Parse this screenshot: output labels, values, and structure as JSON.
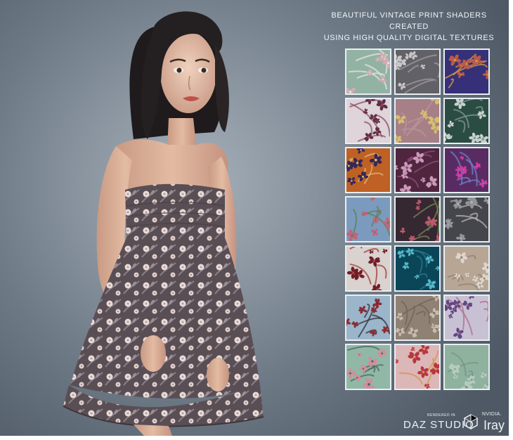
{
  "promo": {
    "headline_line1": "BEAUTIFUL VINTAGE PRINT SHADERS CREATED",
    "headline_line2": "USING HIGH QUALITY DIGITAL TEXTURES"
  },
  "branding": {
    "rendered_in": "RENDERED IN",
    "daz_studio": "DAZ STUDIO",
    "nvidia": "NVIDIA.",
    "iray": "Iray"
  },
  "swatches": [
    {
      "bg": "#9fc3b2",
      "fg": "#e8b9c2",
      "accent": "#f6f6f1"
    },
    {
      "bg": "#6b6a70",
      "fg": "#d9d7d8",
      "accent": "#a9a6aa"
    },
    {
      "bg": "#3a3583",
      "fg": "#c9634f",
      "accent": "#e7a14b"
    },
    {
      "bg": "#f1e7ec",
      "fg": "#6c3147",
      "accent": "#9d5b74"
    },
    {
      "bg": "#b58a93",
      "fg": "#e6d176",
      "accent": "#caa1a9"
    },
    {
      "bg": "#2f5348",
      "fg": "#d8e3df",
      "accent": "#8aa39a"
    },
    {
      "bg": "#d06a28",
      "fg": "#3a2c5e",
      "accent": "#f1c37b"
    },
    {
      "bg": "#572944",
      "fg": "#d9a6c8",
      "accent": "#9b5387"
    },
    {
      "bg": "#60306b",
      "fg": "#e53fb0",
      "accent": "#7a8bd8"
    },
    {
      "bg": "#86a9cf",
      "fg": "#d96a86",
      "accent": "#6c8a5a"
    },
    {
      "bg": "#3a2c36",
      "fg": "#d45d79",
      "accent": "#7d8e62"
    },
    {
      "bg": "#4b4b53",
      "fg": "#9fa0a6",
      "accent": "#c5c0bf"
    },
    {
      "bg": "#ece4e0",
      "fg": "#7b1f2c",
      "accent": "#b44a49"
    },
    {
      "bg": "#0d4c60",
      "fg": "#5ec7d9",
      "accent": "#2a7f94"
    },
    {
      "bg": "#c8b5a2",
      "fg": "#f1e9df",
      "accent": "#a08e7d"
    },
    {
      "bg": "#a9c6dc",
      "fg": "#9e2e3a",
      "accent": "#3f3f4f"
    },
    {
      "bg": "#9c8d7e",
      "fg": "#d8cbbd",
      "accent": "#7e6e60"
    },
    {
      "bg": "#d9d2e6",
      "fg": "#6a4f8e",
      "accent": "#c27a9e"
    },
    {
      "bg": "#9ec7b6",
      "fg": "#e49aa8",
      "accent": "#52756a"
    },
    {
      "bg": "#efc7c7",
      "fg": "#c73b49",
      "accent": "#e9a35c"
    },
    {
      "bg": "#9cc2ad",
      "fg": "#c6ddd1",
      "accent": "#7fa391"
    }
  ]
}
